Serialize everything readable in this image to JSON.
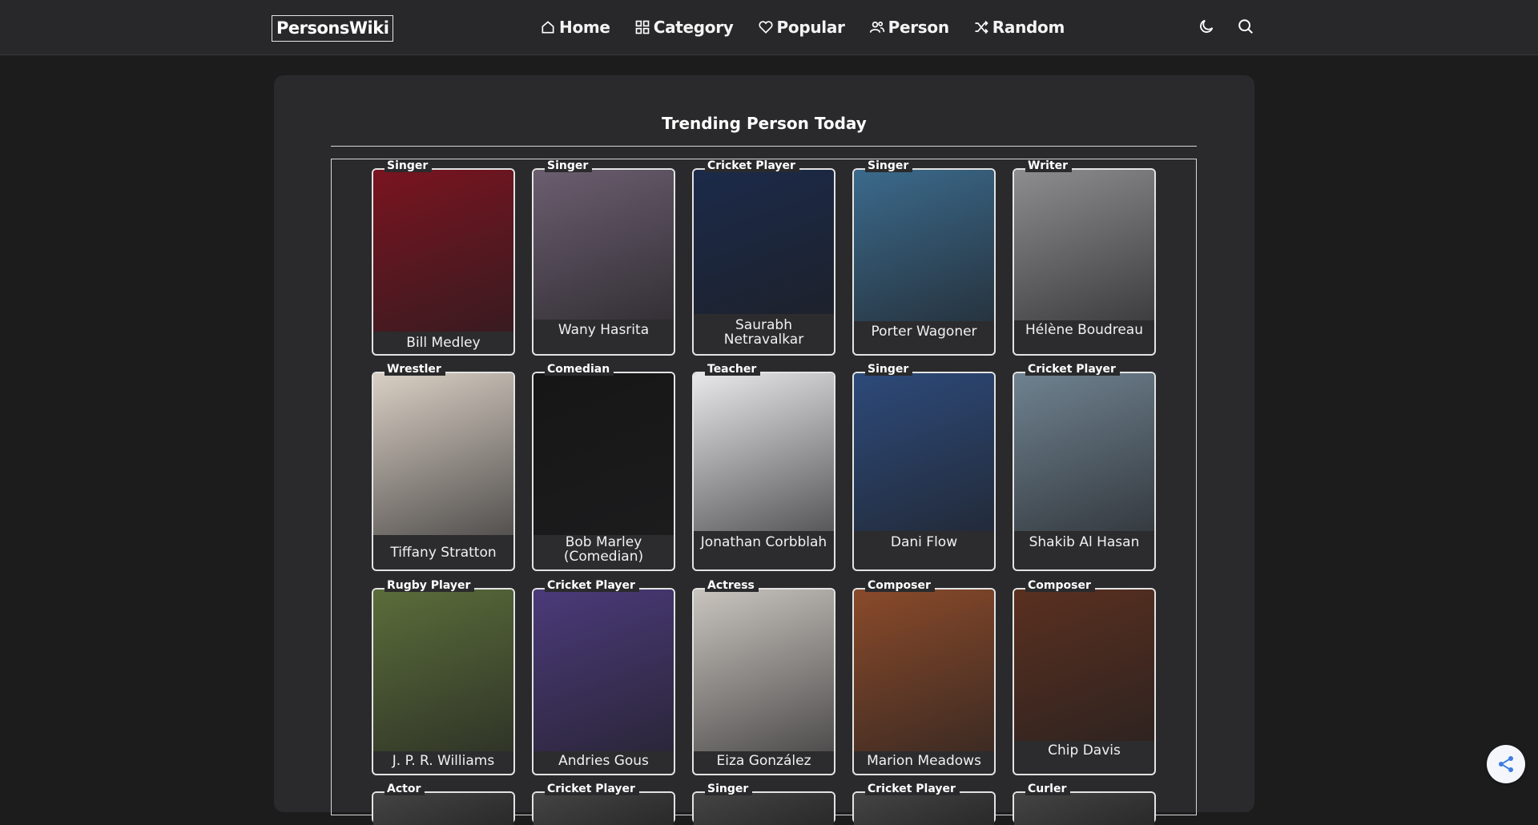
{
  "header": {
    "logo": "PersonsWiki",
    "nav": [
      {
        "label": "Home",
        "icon": "home-icon"
      },
      {
        "label": "Category",
        "icon": "grid-icon"
      },
      {
        "label": "Popular",
        "icon": "heart-icon"
      },
      {
        "label": "Person",
        "icon": "people-icon"
      },
      {
        "label": "Random",
        "icon": "shuffle-icon"
      }
    ],
    "theme_icon": "moon-icon",
    "search_icon": "search-icon"
  },
  "section": {
    "title": "Trending Person Today"
  },
  "persons": [
    {
      "name": "Bill Medley",
      "category": "Singer",
      "color": "#7a1420"
    },
    {
      "name": "Wany Hasrita",
      "category": "Singer",
      "color": "#6b5e6f"
    },
    {
      "name": "Saurabh Netravalkar",
      "category": "Cricket Player",
      "color": "#1b2a4a"
    },
    {
      "name": "Porter Wagoner",
      "category": "Singer",
      "color": "#3b6a8c"
    },
    {
      "name": "Hélène Boudreau",
      "category": "Writer",
      "color": "#8d8d8f"
    },
    {
      "name": "Tiffany Stratton",
      "category": "Wrestler",
      "color": "#d9cfc4"
    },
    {
      "name": "Bob Marley (Comedian)",
      "category": "Comedian",
      "color": "#161616"
    },
    {
      "name": "Jonathan Corbblah",
      "category": "Teacher",
      "color": "#e8e8ea"
    },
    {
      "name": "Dani Flow",
      "category": "Singer",
      "color": "#2d4a7a"
    },
    {
      "name": "Shakib Al Hasan",
      "category": "Cricket Player",
      "color": "#6f8290"
    },
    {
      "name": "J. P. R. Williams",
      "category": "Rugby Player",
      "color": "#5b6d3a"
    },
    {
      "name": "Andries Gous",
      "category": "Cricket Player",
      "color": "#4b3a7a"
    },
    {
      "name": "Eiza González",
      "category": "Actress",
      "color": "#c9c4be"
    },
    {
      "name": "Marion Meadows",
      "category": "Composer",
      "color": "#8a4a2a"
    },
    {
      "name": "Chip Davis",
      "category": "Composer",
      "color": "#5a3020"
    },
    {
      "name": "",
      "category": "Actor",
      "color": "#444"
    },
    {
      "name": "",
      "category": "Cricket Player",
      "color": "#444"
    },
    {
      "name": "",
      "category": "Singer",
      "color": "#444"
    },
    {
      "name": "",
      "category": "Cricket Player",
      "color": "#444"
    },
    {
      "name": "",
      "category": "Curler",
      "color": "#444"
    }
  ],
  "share_icon": "share-icon"
}
